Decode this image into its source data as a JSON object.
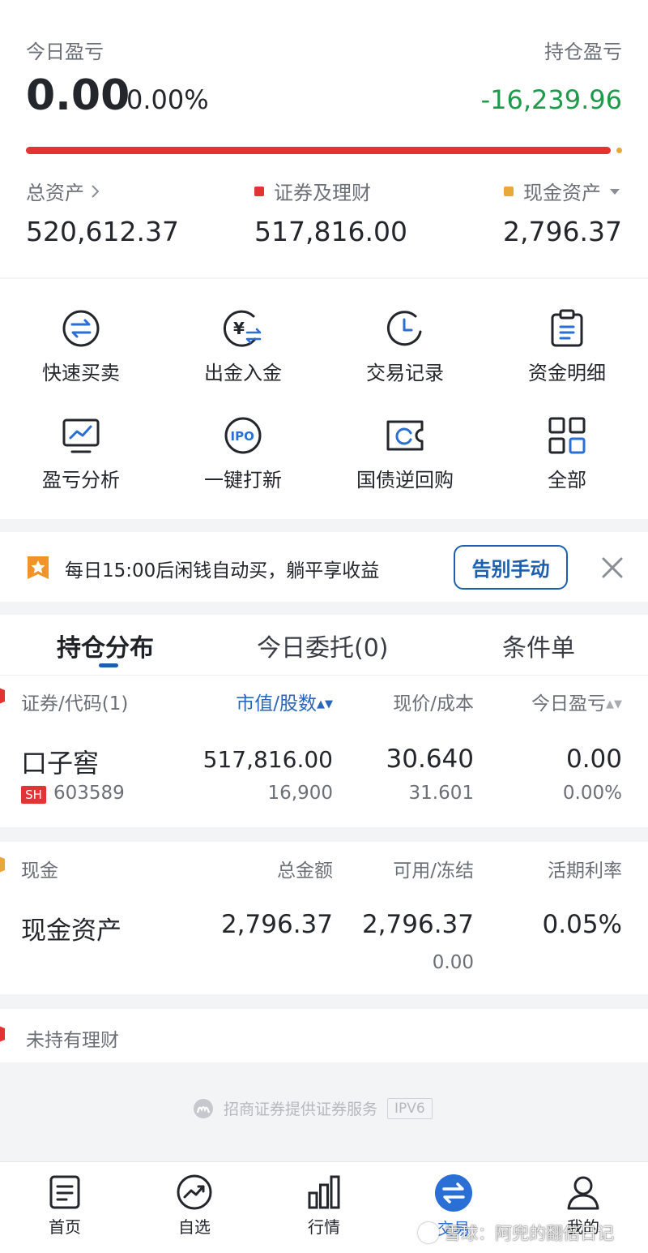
{
  "summary": {
    "today_pnl_label": "今日盈亏",
    "today_pnl_value": "0.00",
    "today_pnl_pct": "0.00%",
    "position_pnl_label": "持仓盈亏",
    "position_pnl_value": "-16,239.96",
    "total_assets_label": "总资产",
    "total_assets_value": "520,612.37",
    "securities_label": "证券及理财",
    "securities_value": "517,816.00",
    "cash_label": "现金资产",
    "cash_value": "2,796.37",
    "securities_share": 0.9946,
    "colors": {
      "securities": "#e23434",
      "cash": "#e8a93a",
      "loss": "#1e9a4a"
    }
  },
  "quick_actions": [
    {
      "label": "快速买卖",
      "icon": "swap-icon"
    },
    {
      "label": "出金入金",
      "icon": "yuan-transfer-icon"
    },
    {
      "label": "交易记录",
      "icon": "clock-icon"
    },
    {
      "label": "资金明细",
      "icon": "clipboard-icon"
    },
    {
      "label": "盈亏分析",
      "icon": "monitor-chart-icon"
    },
    {
      "label": "一键打新",
      "icon": "ipo-icon"
    },
    {
      "label": "国债逆回购",
      "icon": "repo-ticket-icon"
    },
    {
      "label": "全部",
      "icon": "grid-icon"
    }
  ],
  "banner": {
    "text": "每日15:00后闲钱自动买，躺平享收益",
    "button": "告别手动"
  },
  "position_tabs": [
    "持仓分布",
    "今日委托(0)",
    "条件单"
  ],
  "holdings": {
    "headers": [
      "证券/代码(1)",
      "市值/股数",
      "现价/成本",
      "今日盈亏"
    ],
    "rows": [
      {
        "name": "口子窖",
        "market": "SH",
        "code": "603589",
        "market_value": "517,816.00",
        "shares": "16,900",
        "price": "30.640",
        "cost": "31.601",
        "today_pnl": "0.00",
        "today_pnl_pct": "0.00%"
      }
    ]
  },
  "cash_section": {
    "headers": [
      "现金",
      "总金额",
      "可用/冻结",
      "活期利率"
    ],
    "row": {
      "name": "现金资产",
      "total": "2,796.37",
      "available": "2,796.37",
      "frozen": "0.00",
      "rate": "0.05%"
    }
  },
  "wealth": {
    "label": "未持有理财"
  },
  "footer": {
    "text": "招商证券提供证券服务",
    "badge": "IPV6"
  },
  "nav": [
    {
      "label": "首页",
      "icon": "home-doc-icon"
    },
    {
      "label": "自选",
      "icon": "trend-icon"
    },
    {
      "label": "行情",
      "icon": "bar-chart-icon"
    },
    {
      "label": "交易",
      "icon": "swap-circle-icon"
    },
    {
      "label": "我的",
      "icon": "user-icon"
    }
  ],
  "watermark": "雪球：阿兜的翻倍日记"
}
